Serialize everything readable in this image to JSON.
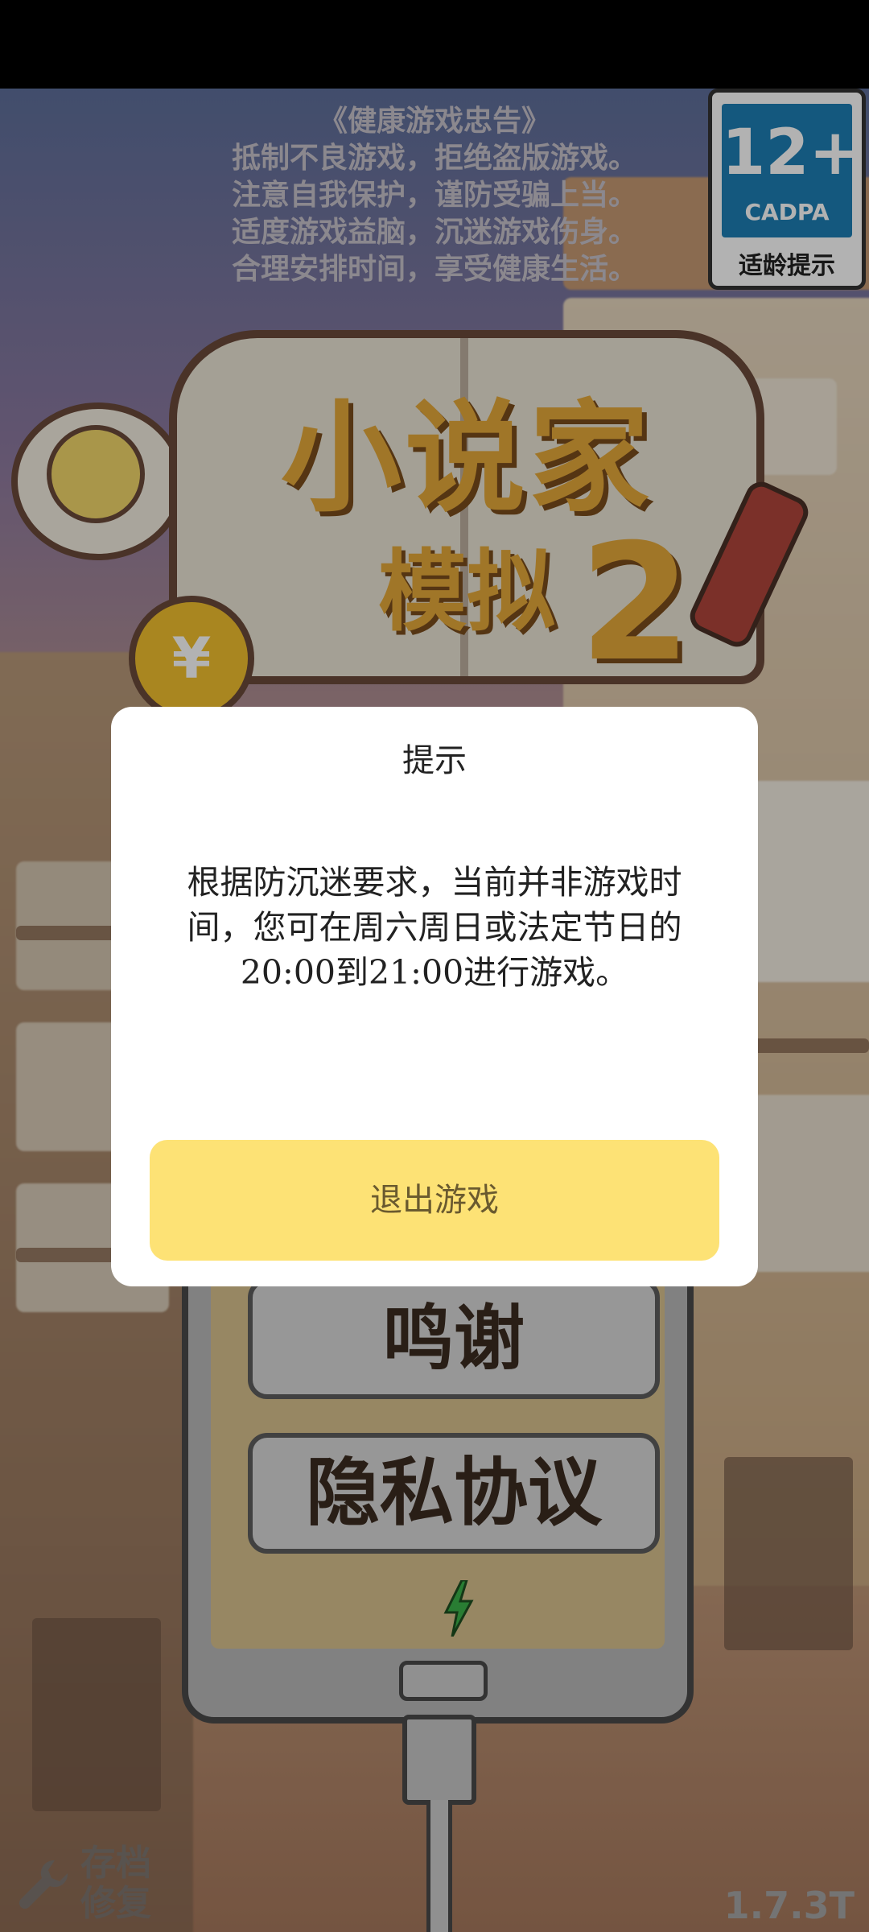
{
  "health_notice": {
    "title": "《健康游戏忠告》",
    "lines": [
      "抵制不良游戏，拒绝盗版游戏。",
      "注意自我保护，谨防受骗上当。",
      "适度游戏益脑，沉迷游戏伤身。",
      "合理安排时间，享受健康生活。"
    ]
  },
  "age_badge": {
    "rating": "12+",
    "org": "CADPA",
    "label": "适龄提示"
  },
  "logo": {
    "line1": "小说家",
    "line2": "模拟",
    "number": "2"
  },
  "menu": {
    "thanks": "鸣谢",
    "privacy": "隐私协议"
  },
  "footer": {
    "repair": "存档修复",
    "version": "1.7.3T"
  },
  "dialog": {
    "title": "提示",
    "message": "根据防沉迷要求，当前并非游戏时间，您可在周六周日或法定节日的20:00到21:00进行游戏。",
    "button": "退出游戏"
  },
  "icons": [
    "lightbulb-icon",
    "coin-icon",
    "lightning-icon",
    "wrench-icon"
  ]
}
